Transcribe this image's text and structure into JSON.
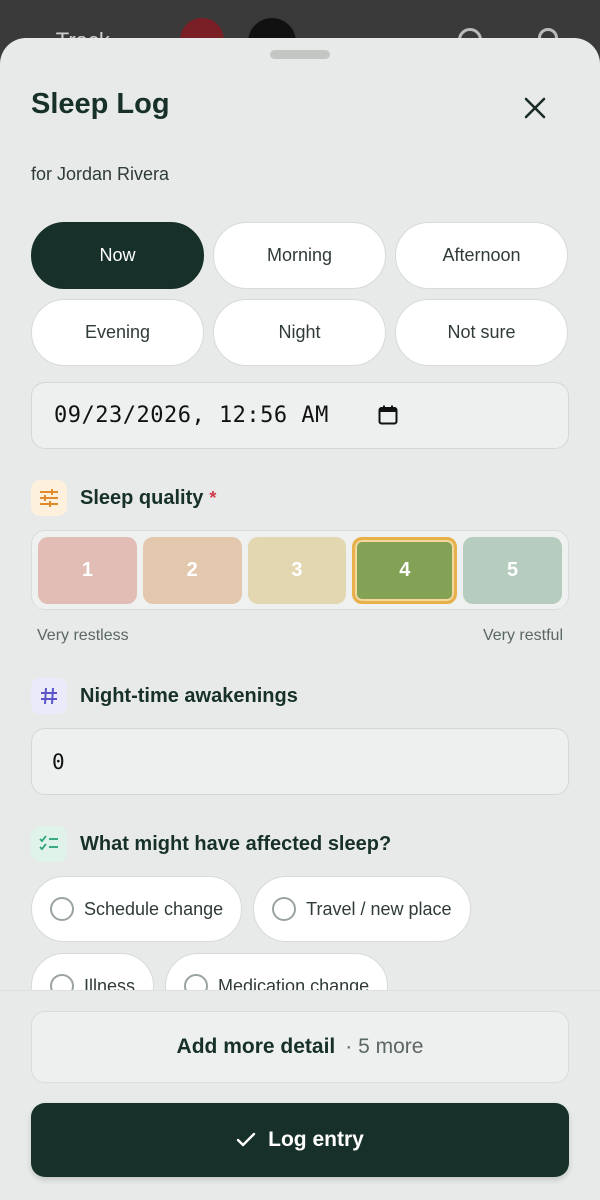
{
  "background": {
    "title_fragment": "← Track"
  },
  "sheet": {
    "title": "Sleep Log",
    "subtitle": "for Jordan Rivera"
  },
  "time_options": [
    {
      "label": "Now",
      "active": true
    },
    {
      "label": "Morning",
      "active": false
    },
    {
      "label": "Afternoon",
      "active": false
    },
    {
      "label": "Evening",
      "active": false
    },
    {
      "label": "Night",
      "active": false
    },
    {
      "label": "Not sure",
      "active": false
    }
  ],
  "datetime": {
    "value": "09/23/2026, 12:56 AM"
  },
  "quality": {
    "label": "Sleep quality",
    "required_mark": "*",
    "options": [
      "1",
      "2",
      "3",
      "4",
      "5"
    ],
    "selected": "4",
    "colors": [
      "#e1bdb5",
      "#e4c8ae",
      "#e3d7b1",
      "#84a256",
      "#b5ccbe"
    ],
    "low_label": "Very restless",
    "high_label": "Very restful"
  },
  "awakenings": {
    "label": "Night-time awakenings",
    "value": "0"
  },
  "factors": {
    "label": "What might have affected sleep?",
    "options": [
      "Schedule change",
      "Travel / new place",
      "Illness",
      "Medication change"
    ]
  },
  "footer": {
    "more_label": "Add more detail",
    "more_count": "· 5 more",
    "log_label": "Log entry"
  },
  "colors": {
    "primary_dark": "#173029",
    "sheet_bg": "#e7eae8",
    "selected_outline": "#e8b04a",
    "required": "#d23b4a"
  }
}
